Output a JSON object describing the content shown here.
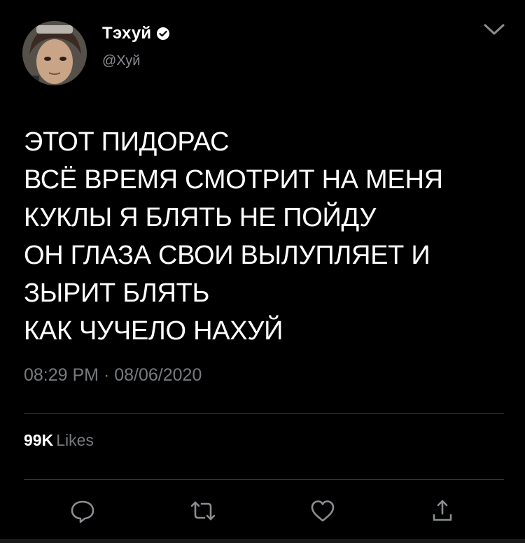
{
  "user": {
    "display_name": "Тэхуй",
    "handle": "@Хуй",
    "verified_icon": "verified-badge-icon",
    "avatar_icon": "avatar-photo"
  },
  "tweet": {
    "lines": [
      "ЭТОТ ПИДОРАС",
      "ВСЁ ВРЕМЯ СМОТРИТ НА МЕНЯ",
      "КУКЛЫ Я БЛЯТЬ НЕ ПОЙДУ",
      "ОН ГЛАЗА СВОИ ВЫЛУПЛЯЕТ И",
      "ЗЫРИТ БЛЯТЬ",
      "КАК ЧУЧЕЛО НАХУЙ"
    ],
    "timestamp": "08:29 PM · 08/06/2020"
  },
  "stats": {
    "likes_count": "99K",
    "likes_label": "Likes"
  },
  "actions": [
    {
      "name": "reply-icon"
    },
    {
      "name": "retweet-icon"
    },
    {
      "name": "like-icon"
    },
    {
      "name": "share-icon"
    }
  ],
  "colors": {
    "background": "#000000",
    "text": "#ffffff",
    "secondary_text": "#8a8d91",
    "divider": "#3a3d40"
  }
}
